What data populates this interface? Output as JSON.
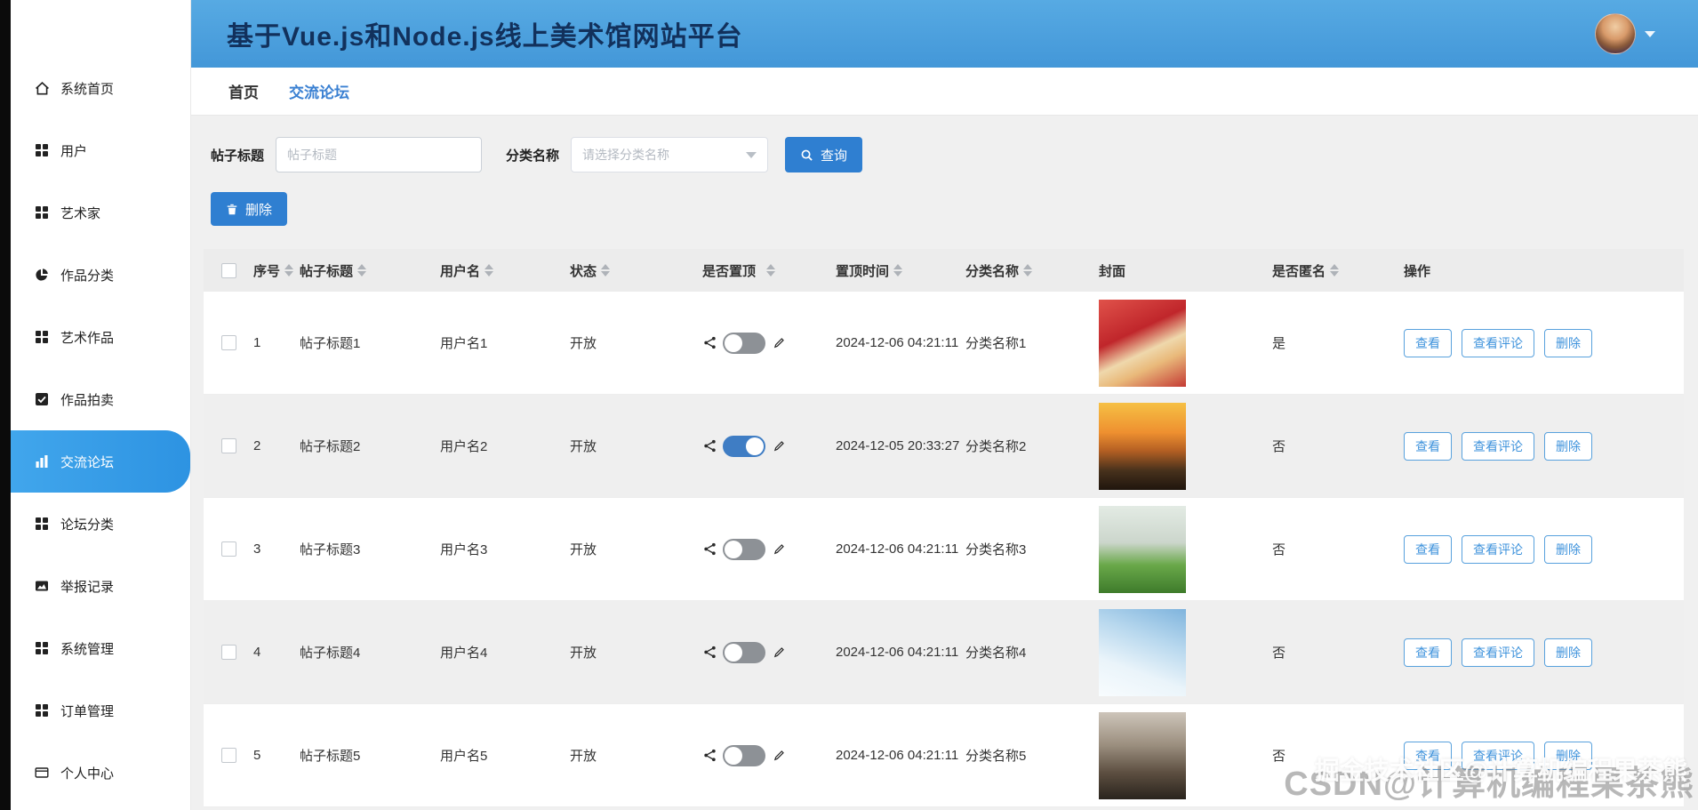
{
  "colors": {
    "header_bg": "#4ba1dd",
    "primary_button": "#2f7fd1",
    "sidebar_active": "#3aa0e8",
    "link_blue": "#3a80d2",
    "switch_on": "#3f7dc4",
    "switch_off": "#8d9196"
  },
  "header": {
    "title": "基于Vue.js和Node.js线上美术馆网站平台"
  },
  "tabs": [
    {
      "label": "首页",
      "active": false
    },
    {
      "label": "交流论坛",
      "active": true
    }
  ],
  "sidebar": {
    "items": [
      {
        "label": "系统首页",
        "icon": "home-icon",
        "active": false
      },
      {
        "label": "用户",
        "icon": "grid-icon",
        "active": false
      },
      {
        "label": "艺术家",
        "icon": "grid-icon",
        "active": false
      },
      {
        "label": "作品分类",
        "icon": "pie-chart-icon",
        "active": false
      },
      {
        "label": "艺术作品",
        "icon": "grid-icon",
        "active": false
      },
      {
        "label": "作品拍卖",
        "icon": "check-square-icon",
        "active": false
      },
      {
        "label": "交流论坛",
        "icon": "bar-chart-icon",
        "active": true
      },
      {
        "label": "论坛分类",
        "icon": "grid-icon",
        "active": false
      },
      {
        "label": "举报记录",
        "icon": "image-icon",
        "active": false
      },
      {
        "label": "系统管理",
        "icon": "grid-icon",
        "active": false
      },
      {
        "label": "订单管理",
        "icon": "grid-icon",
        "active": false
      },
      {
        "label": "个人中心",
        "icon": "card-icon",
        "active": false
      }
    ]
  },
  "filters": {
    "title_label": "帖子标题",
    "title_placeholder": "帖子标题",
    "title_value": "",
    "category_label": "分类名称",
    "category_placeholder": "请选择分类名称",
    "search_button": "查询",
    "delete_button": "删除"
  },
  "table": {
    "columns": [
      "序号",
      "帖子标题",
      "用户名",
      "状态",
      "是否置顶",
      "置顶时间",
      "分类名称",
      "封面",
      "是否匿名",
      "操作"
    ],
    "action_labels": [
      "查看",
      "查看评论",
      "删除"
    ],
    "rows": [
      {
        "no": "1",
        "title": "帖子标题1",
        "user": "用户名1",
        "status": "开放",
        "pinned": false,
        "pin_time": "2024-12-06 04:21:11",
        "category": "分类名称1",
        "cover": "red-berries-dessert",
        "anonymous": "是"
      },
      {
        "no": "2",
        "title": "帖子标题2",
        "user": "用户名2",
        "status": "开放",
        "pinned": true,
        "pin_time": "2024-12-05 20:33:27",
        "category": "分类名称2",
        "cover": "sunset-over-sea",
        "anonymous": "否"
      },
      {
        "no": "3",
        "title": "帖子标题3",
        "user": "用户名3",
        "status": "开放",
        "pinned": false,
        "pin_time": "2024-12-06 04:21:11",
        "category": "分类名称3",
        "cover": "yoga-on-grass",
        "anonymous": "否"
      },
      {
        "no": "4",
        "title": "帖子标题4",
        "user": "用户名4",
        "status": "开放",
        "pinned": false,
        "pin_time": "2024-12-06 04:21:11",
        "category": "分类名称4",
        "cover": "skier-on-snow",
        "anonymous": "否"
      },
      {
        "no": "5",
        "title": "帖子标题5",
        "user": "用户名5",
        "status": "开放",
        "pinned": false,
        "pin_time": "2024-12-06 04:21:11",
        "category": "分类名称5",
        "cover": "group-of-people",
        "anonymous": "否"
      }
    ]
  },
  "watermark": {
    "front": "掘金技术社区@计算机编程果茶熊",
    "back": "CSDN@计算机编程果茶熊"
  }
}
